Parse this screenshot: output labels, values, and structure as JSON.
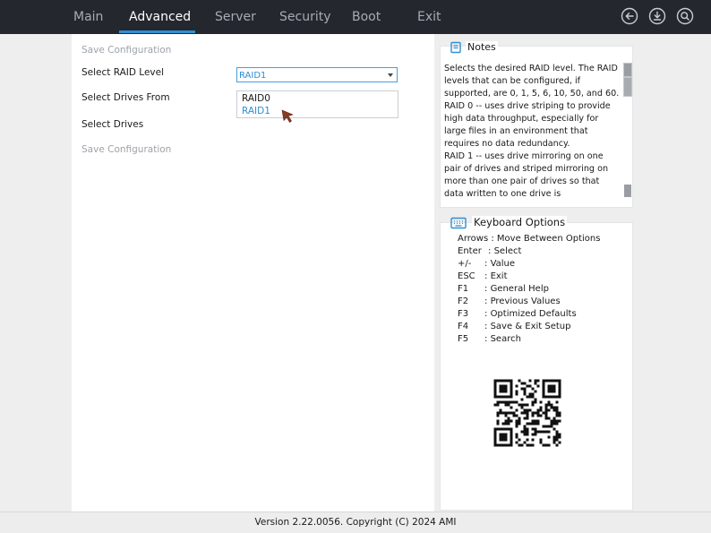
{
  "nav": {
    "tabs": [
      {
        "label": "Main"
      },
      {
        "label": "Advanced"
      },
      {
        "label": "Server"
      },
      {
        "label": "Security"
      },
      {
        "label": "Boot"
      },
      {
        "label": "Exit"
      }
    ],
    "active_tab": "Advanced",
    "icons": [
      "back-arrow-icon",
      "download-icon",
      "search-icon"
    ]
  },
  "content": {
    "save_config_top": "Save Configuration",
    "raid_level_label": "Select RAID Level",
    "raid_level_value": "RAID1",
    "drives_from_label": "Select Drives From",
    "drives_label": "Select Drives",
    "save_config_bottom": "Save Configuration",
    "dropdown_options": [
      "RAID0",
      "RAID1"
    ],
    "dropdown_selected": "RAID1"
  },
  "notes": {
    "title": "Notes",
    "text": "Selects the desired RAID level. The RAID levels that can be configured, if supported, are 0, 1, 5, 6, 10, 50, and 60. RAID 0 -- uses drive striping to provide high data throughput, especially for large files in an environment that requires no data redundancy.\nRAID 1 -- uses drive mirroring on one pair of drives and striped mirroring on more than one pair of drives so that data written to one drive is"
  },
  "keyboard": {
    "title": "Keyboard Options",
    "rows": [
      {
        "key": "Arrows",
        "sep": " : ",
        "desc": "Move Between Options"
      },
      {
        "key": "Enter",
        "sep": " : ",
        "desc": "Select"
      },
      {
        "key": "+/-",
        "sep": " : ",
        "desc": "Value"
      },
      {
        "key": "ESC",
        "sep": " : ",
        "desc": "Exit"
      },
      {
        "key": "F1",
        "sep": " : ",
        "desc": "General Help"
      },
      {
        "key": "F2",
        "sep": " : ",
        "desc": "Previous Values"
      },
      {
        "key": "F3",
        "sep": " : ",
        "desc": "Optimized Defaults"
      },
      {
        "key": "F4",
        "sep": " : ",
        "desc": "Save & Exit Setup"
      },
      {
        "key": "F5",
        "sep": " : ",
        "desc": "Search"
      }
    ]
  },
  "footer": {
    "version": "Version 2.22.0056. Copyright (C) 2024 AMI"
  },
  "colors": {
    "topbar": "#24272e",
    "accent": "#2f8fd4",
    "link_text": "#2b8fd0",
    "disabled_text": "#9ea2a8"
  }
}
